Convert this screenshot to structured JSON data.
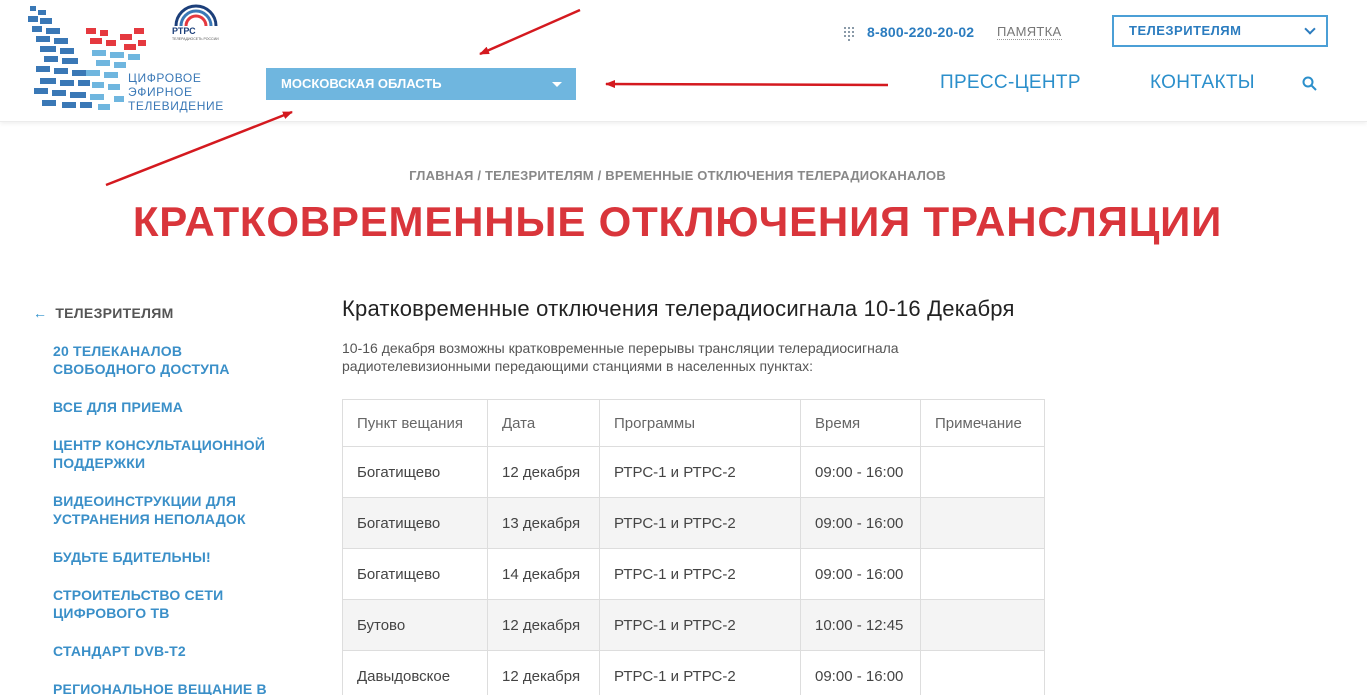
{
  "header": {
    "logo_lines": [
      "ЦИФРОВОЕ",
      "ЭФИРНОЕ",
      "ТЕЛЕВИДЕНИЕ"
    ],
    "rtrs_label": "РТРС",
    "rtrs_sub": "ТЕЛЕРАДИОСЕТЬ РОССИИ",
    "region": "МОСКОВСКАЯ ОБЛАСТЬ",
    "phone": "8-800-220-20-02",
    "memo": "ПАМЯТКА",
    "viewers": "ТЕЛЕЗРИТЕЛЯМ",
    "nav": [
      "ПРЕСС-ЦЕНТР",
      "КОНТАКТЫ"
    ]
  },
  "breadcrumb": [
    "ГЛАВНАЯ",
    "ТЕЛЕЗРИТЕЛЯМ",
    "ВРЕМЕННЫЕ ОТКЛЮЧЕНИЯ ТЕЛЕРАДИОКАНАЛОВ"
  ],
  "breadcrumb_sep": " / ",
  "page_title": "КРАТКОВРЕМЕННЫЕ ОТКЛЮЧЕНИЯ ТРАНСЛЯЦИИ",
  "sidebar": {
    "back": "ТЕЛЕЗРИТЕЛЯМ",
    "items": [
      [
        "20 ТЕЛЕКАНАЛОВ",
        "СВОБОДНОГО ДОСТУПА"
      ],
      [
        "ВСЕ ДЛЯ ПРИЕМА"
      ],
      [
        "ЦЕНТР КОНСУЛЬТАЦИОННОЙ",
        "ПОДДЕРЖКИ"
      ],
      [
        "ВИДЕОИНСТРУКЦИИ ДЛЯ",
        "УСТРАНЕНИЯ НЕПОЛАДОК"
      ],
      [
        "БУДЬТЕ БДИТЕЛЬНЫ!"
      ],
      [
        "СТРОИТЕЛЬСТВО СЕТИ",
        "ЦИФРОВОГО ТВ"
      ],
      [
        "СТАНДАРТ DVB-T2"
      ],
      [
        "РЕГИОНАЛЬНОЕ ВЕЩАНИЕ В"
      ]
    ]
  },
  "content": {
    "heading": "Кратковременные отключения телерадиосигнала 10-16 Декабря",
    "intro_lines": [
      "10-16 декабря возможны кратковременные перерывы трансляции телерадиосигнала",
      "радиотелевизионными передающими станциями в населенных пунктах:"
    ]
  },
  "table": {
    "columns": [
      "Пункт вещания",
      "Дата",
      "Программы",
      "Время",
      "Примечание"
    ],
    "rows": [
      [
        "Богатищево",
        "12 декабря",
        "РТРС-1 и РТРС-2",
        "09:00 - 16:00",
        ""
      ],
      [
        "Богатищево",
        "13 декабря",
        "РТРС-1 и РТРС-2",
        "09:00 - 16:00",
        ""
      ],
      [
        "Богатищево",
        "14 декабря",
        "РТРС-1 и РТРС-2",
        "09:00 - 16:00",
        ""
      ],
      [
        "Бутово",
        "12 декабря",
        "РТРС-1 и РТРС-2",
        "10:00 - 12:45",
        ""
      ],
      [
        "Давыдовское",
        "12 декабря",
        "РТРС-1 и РТРС-2",
        "09:00 - 16:00",
        ""
      ]
    ]
  },
  "colors": {
    "accent": "#2b8fcb",
    "title_red": "#d9353b",
    "region_bg": "#6fb6df",
    "arrow": "#d4191f"
  }
}
